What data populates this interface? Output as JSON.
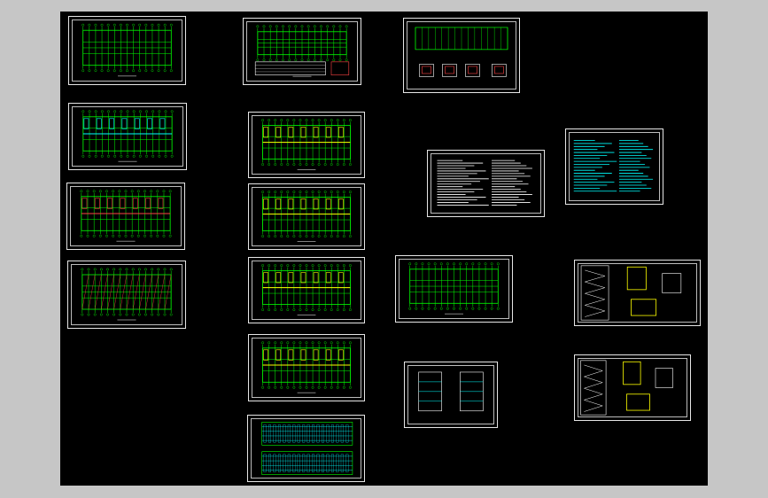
{
  "window": {
    "title": ""
  },
  "colors": {
    "background": "#000000",
    "frame": "#ffffff",
    "grid_green": "#00ff00",
    "cyan": "#00ffff",
    "yellow": "#ffff00",
    "red": "#ff0000",
    "outer": "#c6c6c6"
  },
  "sheets": [
    {
      "name": "sheet-01-plan",
      "type": "plan",
      "accent": "#00ff00"
    },
    {
      "name": "sheet-02-plan-cyan",
      "type": "plan",
      "accent": "#00ffff"
    },
    {
      "name": "sheet-03-plan-red",
      "type": "plan",
      "accent": "#ff4444"
    },
    {
      "name": "sheet-04-plan-diag",
      "type": "plan",
      "accent": "#00ff00"
    },
    {
      "name": "sheet-05-plan-table",
      "type": "plan-table",
      "accent": "#00ff00"
    },
    {
      "name": "sheet-06-plan-yellow",
      "type": "plan",
      "accent": "#ffff00"
    },
    {
      "name": "sheet-07-plan-yellow",
      "type": "plan",
      "accent": "#ffff00"
    },
    {
      "name": "sheet-08-plan-yellow",
      "type": "plan",
      "accent": "#ffff00"
    },
    {
      "name": "sheet-09-plan-yellow",
      "type": "plan",
      "accent": "#ffff00"
    },
    {
      "name": "sheet-10-elevation",
      "type": "elevation",
      "accent": "#00ffff"
    },
    {
      "name": "sheet-11-foundation",
      "type": "foundation",
      "accent": "#00ff00"
    },
    {
      "name": "sheet-12-notes",
      "type": "notes",
      "accent": "#ffffff"
    },
    {
      "name": "sheet-13-notes-cyan",
      "type": "notes",
      "accent": "#00ffff"
    },
    {
      "name": "sheet-14-plan-rooms",
      "type": "plan",
      "accent": "#00ff00"
    },
    {
      "name": "sheet-15-stair-detail",
      "type": "stair",
      "accent": "#ffff00"
    },
    {
      "name": "sheet-16-section",
      "type": "section",
      "accent": "#00ffff"
    },
    {
      "name": "sheet-17-stair-detail",
      "type": "stair",
      "accent": "#ffff00"
    }
  ]
}
